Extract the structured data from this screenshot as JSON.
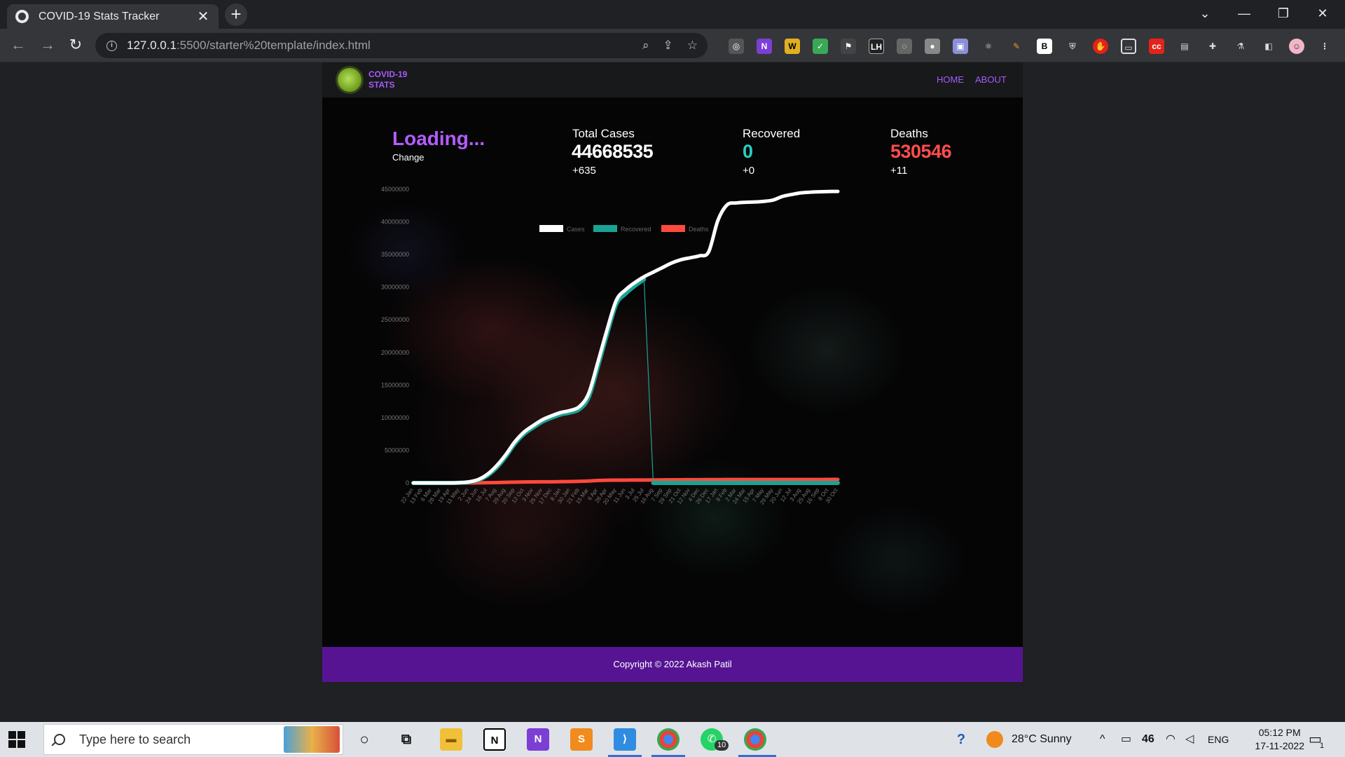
{
  "browser": {
    "tab_title": "COVID-19 Stats Tracker",
    "new_tab": "+",
    "url_host": "127.0.0.1",
    "url_path": ":5500/starter%20template/index.html"
  },
  "site": {
    "logo_line1": "COVID-19",
    "logo_line2": "STATS",
    "nav": {
      "home": "HOME",
      "about": "ABOUT"
    },
    "country": {
      "title": "Loading...",
      "change": "Change"
    },
    "stats": {
      "total": {
        "label": "Total Cases",
        "value": "44668535",
        "delta": "+635",
        "color": "#ffffff"
      },
      "recovered": {
        "label": "Recovered",
        "value": "0",
        "delta": "+0",
        "color": "#24d1c4"
      },
      "deaths": {
        "label": "Deaths",
        "value": "530546",
        "delta": "+11",
        "color": "#ff4d4d"
      }
    },
    "footer": "Copyright © 2022 Akash Patil"
  },
  "chart_data": {
    "type": "line",
    "legend_position": "top-center",
    "legend": [
      {
        "name": "Cases",
        "color": "#ffffff"
      },
      {
        "name": "Recovered",
        "color": "#1aa394"
      },
      {
        "name": "Deaths",
        "color": "#ff4a3d"
      }
    ],
    "ylim": [
      0,
      45000000
    ],
    "y_ticks": [
      "0",
      "5000000",
      "10000000",
      "15000000",
      "20000000",
      "25000000",
      "30000000",
      "35000000",
      "40000000",
      "45000000"
    ],
    "x_ticks": [
      "22 Jan",
      "13 Feb",
      "6 Mar",
      "28 Mar",
      "19 Apr",
      "11 May",
      "2 Jun",
      "24 Jun",
      "16 Jul",
      "7 Aug",
      "29 Aug",
      "20 Sep",
      "12 Oct",
      "3 Nov",
      "25 Nov",
      "17 Dec",
      "8 Jan",
      "30 Jan",
      "21 Feb",
      "15 Mar",
      "6 Apr",
      "28 Apr",
      "20 May",
      "11 Jun",
      "3 Jul",
      "25 Jul",
      "16 Aug",
      "7 Sep",
      "29 Sep",
      "21 Oct",
      "12 Nov",
      "4 Dec",
      "26 Dec",
      "17 Jan",
      "8 Feb",
      "2 Mar",
      "24 Mar",
      "15 Apr",
      "7 May",
      "29 May",
      "20 Jun",
      "12 Jul",
      "3 Aug",
      "25 Aug",
      "16 Sep",
      "8 Oct",
      "30 Oct"
    ],
    "series": [
      {
        "name": "Cases",
        "color": "#ffffff",
        "values": [
          0,
          0,
          0,
          0,
          0,
          40000,
          150000,
          500000,
          1300000,
          2600000,
          4300000,
          6300000,
          7800000,
          8800000,
          9700000,
          10300000,
          10800000,
          11100000,
          11700000,
          13700000,
          18500000,
          23500000,
          28000000,
          29600000,
          30700000,
          31600000,
          32300000,
          33000000,
          33700000,
          34200000,
          34500000,
          34800000,
          35400000,
          40200000,
          42600000,
          42900000,
          43000000,
          43050000,
          43150000,
          43350000,
          43900000,
          44200000,
          44450000,
          44550000,
          44610000,
          44650000,
          44668535
        ]
      },
      {
        "name": "Recovered",
        "color": "#1aa394",
        "values": [
          0,
          0,
          0,
          0,
          0,
          30000,
          120000,
          420000,
          1100000,
          2300000,
          4000000,
          6000000,
          7500000,
          8500000,
          9400000,
          10000000,
          10500000,
          10800000,
          11300000,
          13100000,
          17800000,
          22800000,
          27400000,
          29000000,
          30200000,
          31200000,
          0,
          0,
          0,
          0,
          0,
          0,
          0,
          0,
          0,
          0,
          0,
          0,
          0,
          0,
          0,
          0,
          0,
          0,
          0,
          0,
          0
        ]
      },
      {
        "name": "Deaths",
        "color": "#ff4a3d",
        "values": [
          0,
          0,
          0,
          0,
          0,
          1000,
          6000,
          17000,
          35000,
          60000,
          90000,
          120000,
          145000,
          160000,
          170000,
          180000,
          195000,
          210000,
          250000,
          300000,
          380000,
          420000,
          430000,
          436000,
          440000,
          445000,
          455000,
          470000,
          482000,
          490000,
          495000,
          500000,
          510000,
          515000,
          520000,
          522000,
          524000,
          525000,
          526000,
          527000,
          527500,
          528000,
          529000,
          529600,
          530000,
          530300,
          530546
        ]
      }
    ]
  },
  "taskbar": {
    "search_placeholder": "Type here to search",
    "weather": "28°C  Sunny",
    "battery": "46",
    "lang": "ENG",
    "time": "05:12 PM",
    "date": "17-11-2022",
    "whatsapp_badge": "10",
    "notif_badge": "1"
  }
}
